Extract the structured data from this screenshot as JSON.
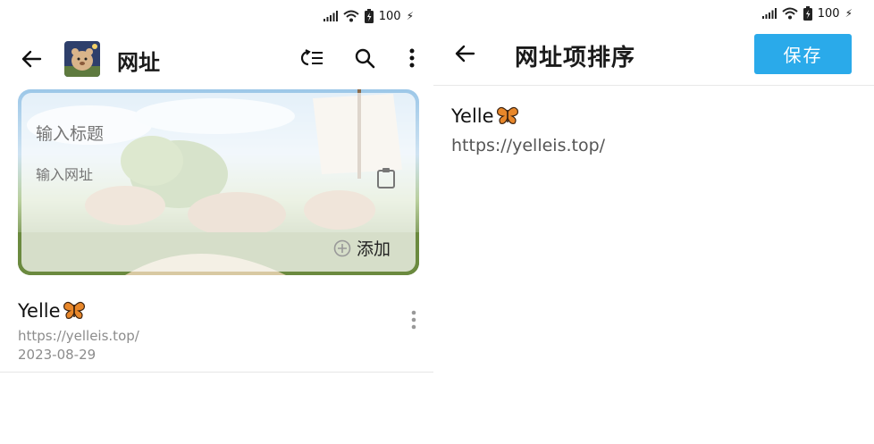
{
  "status_bar": {
    "battery": "100"
  },
  "list_screen": {
    "title": "网址",
    "form": {
      "title_placeholder": "输入标题",
      "url_placeholder": "输入网址",
      "add_label": "添加"
    },
    "items": [
      {
        "title": "Yelle",
        "url": "https://yelleis.top/",
        "date": "2023-08-29"
      }
    ]
  },
  "sort_screen": {
    "title": "网址项排序",
    "save_label": "保存",
    "items": [
      {
        "title": "Yelle",
        "url": "https://yelleis.top/"
      }
    ]
  },
  "colors": {
    "accent": "#2aaaea",
    "text": "#1a1a1a",
    "muted": "#8c8c8c"
  },
  "icons": [
    "signal-icon",
    "wifi-icon",
    "battery-icon",
    "back-arrow-icon",
    "sort-icon",
    "search-icon",
    "more-icon",
    "clipboard-icon",
    "add-circle-icon",
    "butterfly-icon"
  ]
}
